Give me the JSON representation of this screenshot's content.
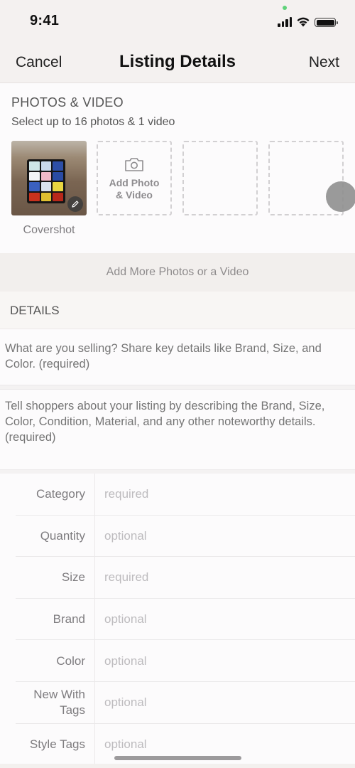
{
  "status_bar": {
    "time": "9:41",
    "icons": [
      "cellular-signal-icon",
      "wifi-icon",
      "battery-icon"
    ],
    "privacy_dot_color": "#5fd27a"
  },
  "nav": {
    "cancel_label": "Cancel",
    "title": "Listing Details",
    "next_label": "Next"
  },
  "photos": {
    "heading": "PHOTOS & VIDEO",
    "subtitle": "Select up to 16 photos & 1 video",
    "cover_label": "Covershot",
    "cover_icon": "pencil-icon",
    "add_label_line1": "Add Photo",
    "add_label_line2": "& Video",
    "add_icon": "camera-icon",
    "empty_slots": 2,
    "add_more_label": "Add More Photos or a Video"
  },
  "details": {
    "heading": "DETAILS",
    "title_placeholder": "What are you selling? Share key details like Brand, Size, and Color. (required)",
    "description_placeholder": "Tell shoppers about your listing by describing the Brand, Size, Color, Condition, Material, and any other noteworthy details. (required)",
    "attributes": [
      {
        "label": "Category",
        "placeholder": "required"
      },
      {
        "label": "Quantity",
        "placeholder": "optional"
      },
      {
        "label": "Size",
        "placeholder": "required"
      },
      {
        "label": "Brand",
        "placeholder": "optional"
      },
      {
        "label": "Color",
        "placeholder": "optional"
      },
      {
        "label": "New With Tags",
        "placeholder": "optional"
      },
      {
        "label": "Style Tags",
        "placeholder": "optional"
      }
    ]
  }
}
